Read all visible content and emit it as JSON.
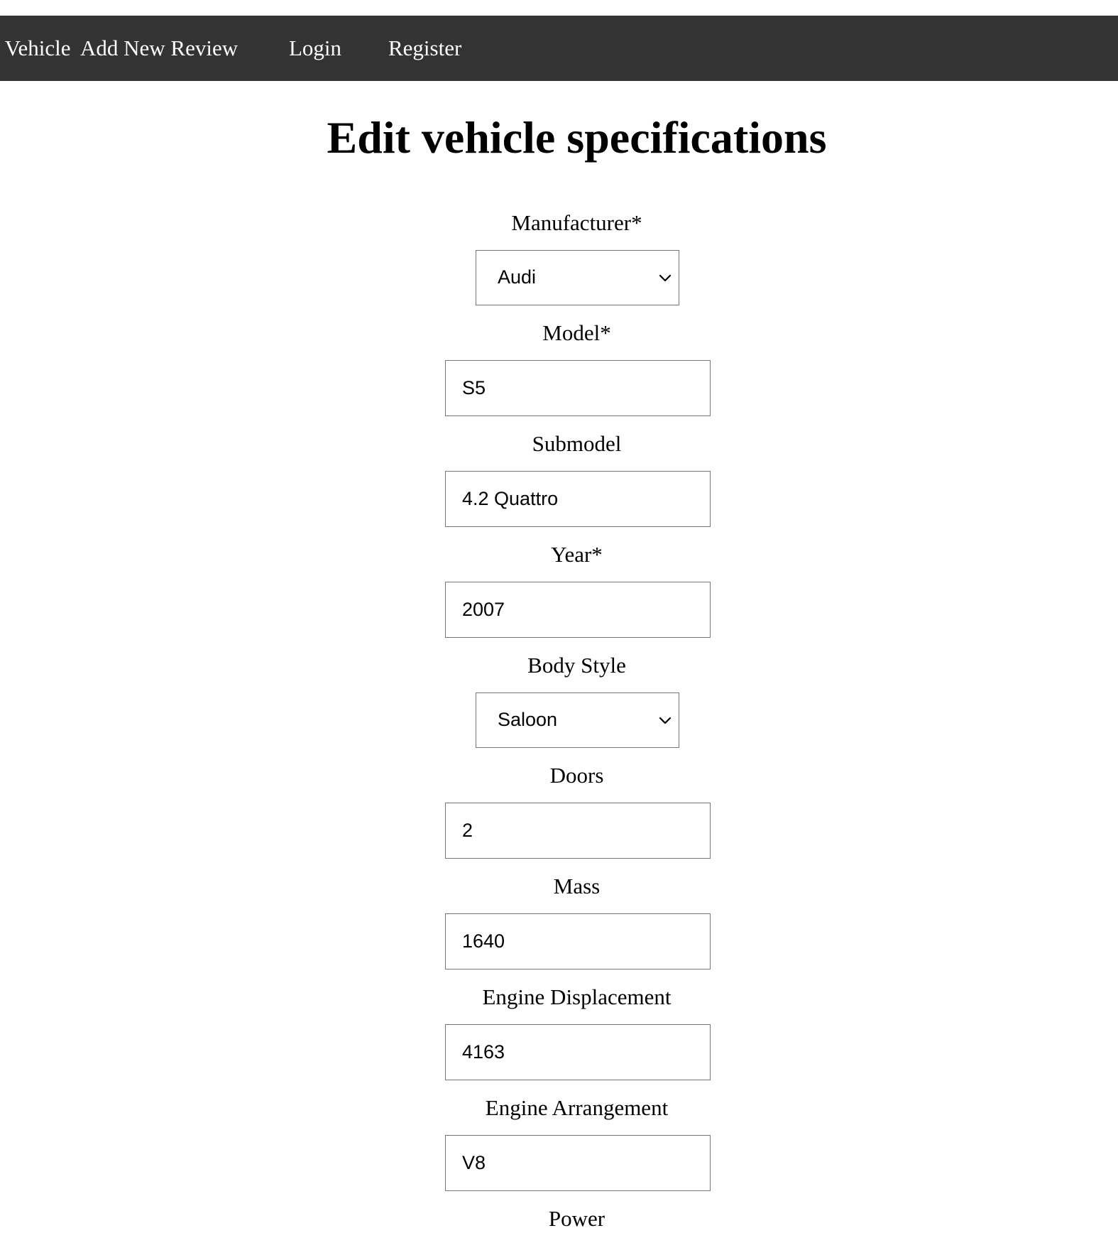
{
  "nav": {
    "items": [
      {
        "label": "Add Vehicle"
      },
      {
        "label": "Add New Review"
      },
      {
        "label": "Login"
      },
      {
        "label": "Register"
      }
    ]
  },
  "page_title": "Edit vehicle specifications",
  "form": {
    "manufacturer": {
      "label": "Manufacturer*",
      "value": "Audi"
    },
    "model": {
      "label": "Model*",
      "value": "S5"
    },
    "submodel": {
      "label": "Submodel",
      "value": "4.2 Quattro"
    },
    "year": {
      "label": "Year*",
      "value": "2007"
    },
    "body_style": {
      "label": "Body Style",
      "value": "Saloon"
    },
    "doors": {
      "label": "Doors",
      "value": "2"
    },
    "mass": {
      "label": "Mass",
      "value": "1640"
    },
    "engine_displacement": {
      "label": "Engine Displacement",
      "value": "4163"
    },
    "engine_arrangement": {
      "label": "Engine Arrangement",
      "value": "V8"
    },
    "power": {
      "label": "Power"
    }
  },
  "icons": {
    "select_arrow": "chevron-down-icon"
  },
  "colors": {
    "navbar_bg": "#333333",
    "navbar_text": "#ffffff",
    "input_border": "#767676"
  }
}
